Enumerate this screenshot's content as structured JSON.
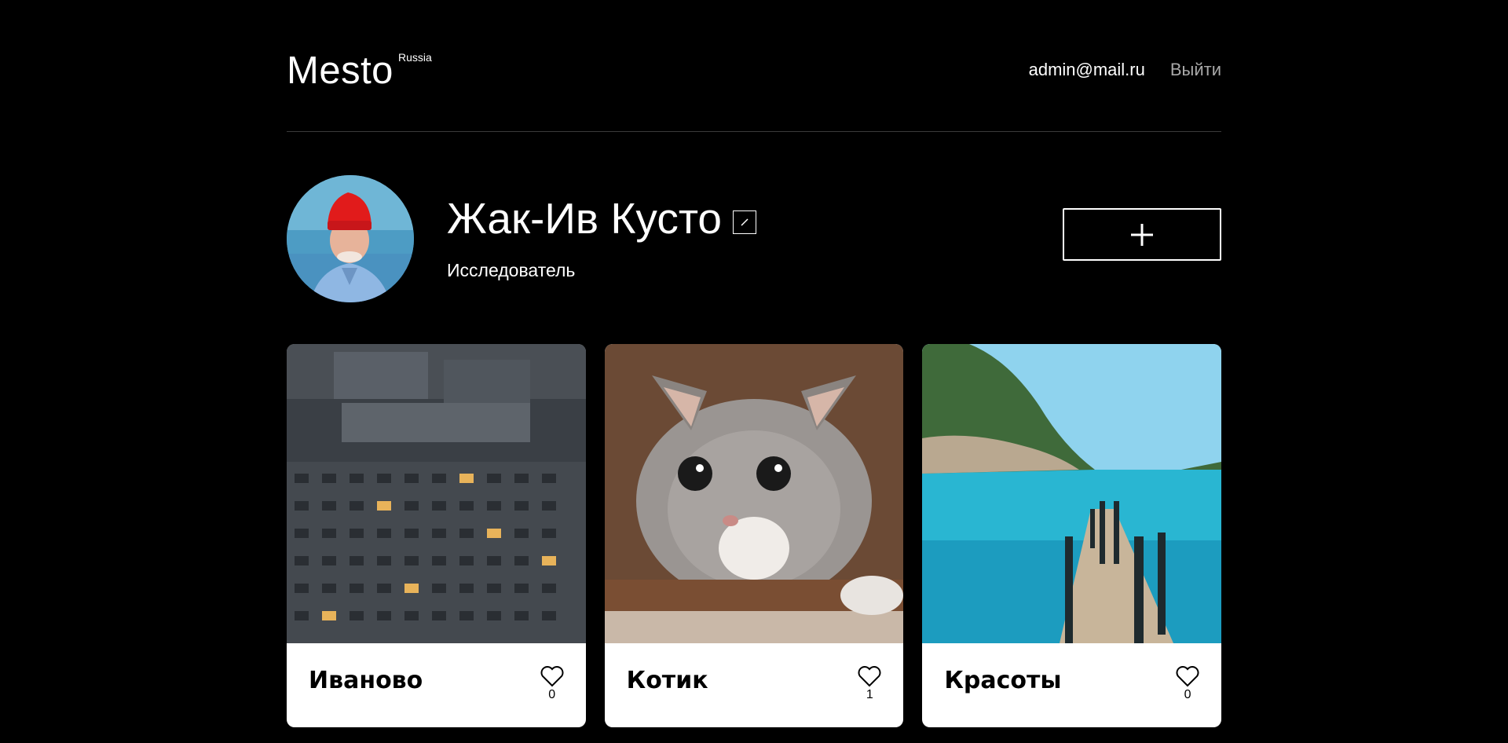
{
  "header": {
    "logo": "Mesto",
    "logo_sub": "Russia",
    "email": "admin@mail.ru",
    "logout": "Выйти"
  },
  "profile": {
    "name": "Жак-Ив Кусто",
    "about": "Исследователь",
    "edit_icon": "pencil-icon",
    "add_icon": "plus-icon"
  },
  "cards": [
    {
      "title": "Иваново",
      "likes": "0"
    },
    {
      "title": "Котик",
      "likes": "1"
    },
    {
      "title": "Красоты",
      "likes": "0"
    }
  ],
  "colors": {
    "background": "#000000",
    "card": "#ffffff",
    "logout": "#a9a9a9",
    "divider": "#545454"
  }
}
